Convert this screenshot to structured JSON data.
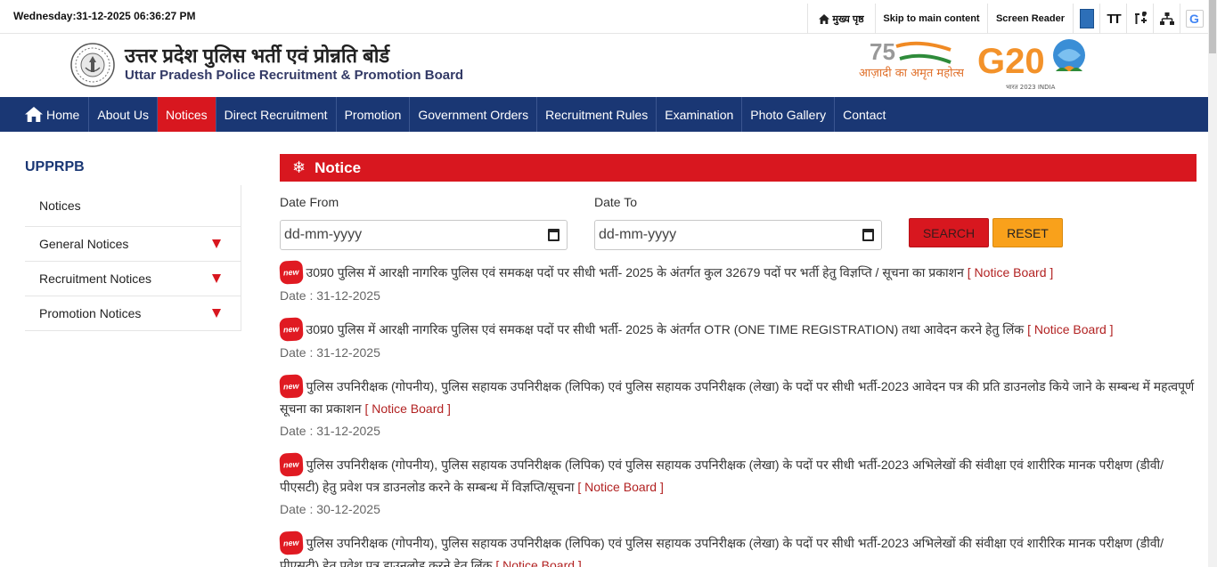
{
  "topbar": {
    "datetime": "Wednesday:31-12-2025 06:36:27 PM",
    "home_label": "मुख्य पृष्ठ",
    "skip_label": "Skip to main content",
    "reader_label": "Screen Reader",
    "text_size_label": "TT",
    "google_label": "G"
  },
  "header": {
    "title_hi": "उत्तर प्रदेश पुलिस भर्ती एवं प्रोन्नति बोर्ड",
    "title_en": "Uttar Pradesh Police Recruitment & Promotion Board",
    "azadi_hi": "आज़ादी का अमृत महोत्सव",
    "g20_text": "G20",
    "g20_sub": "भारत 2023 INDIA"
  },
  "nav": {
    "items": [
      {
        "label": "Home"
      },
      {
        "label": "About Us"
      },
      {
        "label": "Notices"
      },
      {
        "label": "Direct Recruitment"
      },
      {
        "label": "Promotion"
      },
      {
        "label": "Government Orders"
      },
      {
        "label": "Recruitment Rules"
      },
      {
        "label": "Examination"
      },
      {
        "label": "Photo Gallery"
      },
      {
        "label": "Contact"
      }
    ],
    "active": "Notices"
  },
  "sidebar": {
    "title": "UPPRPB",
    "items": [
      {
        "label": "Notices"
      },
      {
        "label": "General Notices"
      },
      {
        "label": "Recruitment Notices"
      },
      {
        "label": "Promotion Notices"
      }
    ]
  },
  "main": {
    "heading": "Notice",
    "filter": {
      "from_label": "Date From",
      "to_label": "Date To",
      "from_placeholder": "dd-mm-yyyy",
      "to_placeholder": "dd-mm-yyyy",
      "search_label": "SEARCH",
      "reset_label": "RESET"
    },
    "badge_label": "new",
    "link_label": "[ Notice Board ]",
    "notices": [
      {
        "text": "उ0प्र0 पुलिस में आरक्षी नागरिक पुलिस एवं समकक्ष पदों पर सीधी भर्ती- 2025 के अंतर्गत कुल 32679 पदों पर भर्ती हेतु विज्ञप्ति / सूचना का प्रकाशन",
        "date": "Date : 31-12-2025"
      },
      {
        "text": "उ0प्र0 पुलिस में आरक्षी नागरिक पुलिस एवं समकक्ष पदों पर सीधी भर्ती- 2025 के अंतर्गत OTR (ONE TIME REGISTRATION) तथा आवेदन करने हेतु लिंक",
        "date": "Date : 31-12-2025"
      },
      {
        "text": "पुलिस उपनिरीक्षक (गोपनीय), पुलिस सहायक उपनिरीक्षक (लिपिक) एवं पुलिस सहायक उपनिरीक्षक (लेखा) के पदों पर सीधी भर्ती-2023 आवेदन पत्र की प्रति डाउनलोड किये जाने के सम्बन्ध में महत्वपूर्ण सूचना का प्रकाशन",
        "date": "Date : 31-12-2025"
      },
      {
        "text": "पुलिस उपनिरीक्षक (गोपनीय), पुलिस सहायक उपनिरीक्षक (लिपिक) एवं पुलिस सहायक उपनिरीक्षक (लेखा) के पदों पर सीधी भर्ती-2023 अभिलेखों की संवीक्षा एवं शारीरिक मानक परीक्षण (डीवी/पीएसटी) हेतु प्रवेश पत्र डाउनलोड करने के सम्बन्ध में विज्ञप्ति/सूचना",
        "date": "Date : 30-12-2025"
      },
      {
        "text": "पुलिस उपनिरीक्षक (गोपनीय), पुलिस सहायक उपनिरीक्षक (लिपिक) एवं पुलिस सहायक उपनिरीक्षक (लेखा) के पदों पर सीधी भर्ती-2023 अभिलेखों की संवीक्षा एवं शारीरिक मानक परीक्षण (डीवी/पीएसटी) हेतु प्रवेश पत्र डाउनलोड करने हेतु लिंक",
        "date": ""
      }
    ]
  }
}
